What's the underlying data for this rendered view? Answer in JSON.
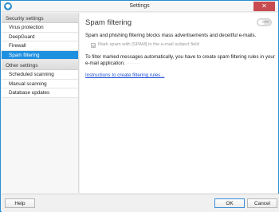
{
  "window": {
    "title": "Settings",
    "close_glyph": "✕"
  },
  "sidebar": {
    "security_header": "Security settings",
    "security_items": [
      "Virus protection",
      "DeepGuard",
      "Firewall",
      "Spam filtering"
    ],
    "other_header": "Other settings",
    "other_items": [
      "Scheduled scanning",
      "Manual scanning",
      "Database updates"
    ]
  },
  "content": {
    "title": "Spam filtering",
    "toggle_label": "OFF",
    "description": "Spam and phishing filtering blocks mass advertisements and deceitful e-mails.",
    "checkbox_label": "Mark spam with [SPAM] in the e-mail subject field",
    "rules_text": "To filter marked messages automatically, you have to create spam filtering rules in your e-mail application.",
    "rules_text_trailing": " ········",
    "link_text": "Instructions to create filtering rules..."
  },
  "footer": {
    "help": "Help",
    "ok": "OK",
    "cancel": "Cancel"
  },
  "colors": {
    "accent": "#1e90e0",
    "close": "#c74b50",
    "link": "#1f4fd6"
  }
}
